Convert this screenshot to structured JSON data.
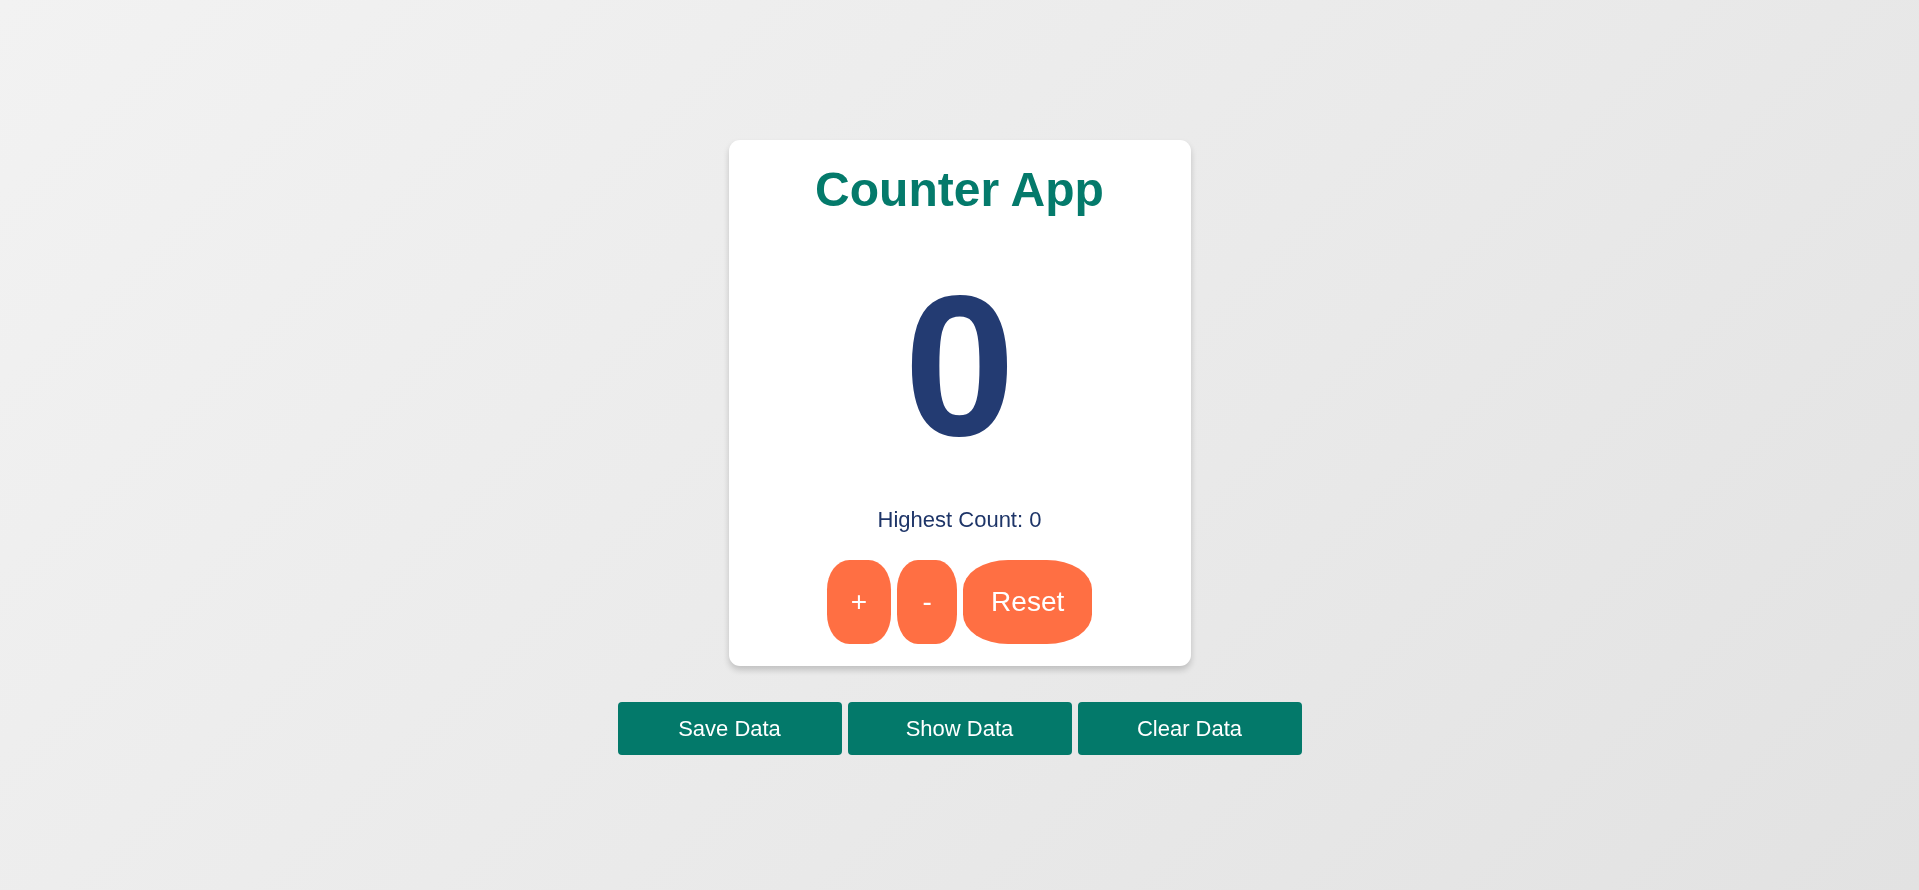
{
  "card": {
    "title": "Counter App",
    "count": "0",
    "highest_count": "Highest Count: 0",
    "buttons": [
      "+",
      "-",
      "Reset"
    ]
  },
  "data_buttons": [
    "Save Data",
    "Show Data",
    "Clear Data"
  ]
}
